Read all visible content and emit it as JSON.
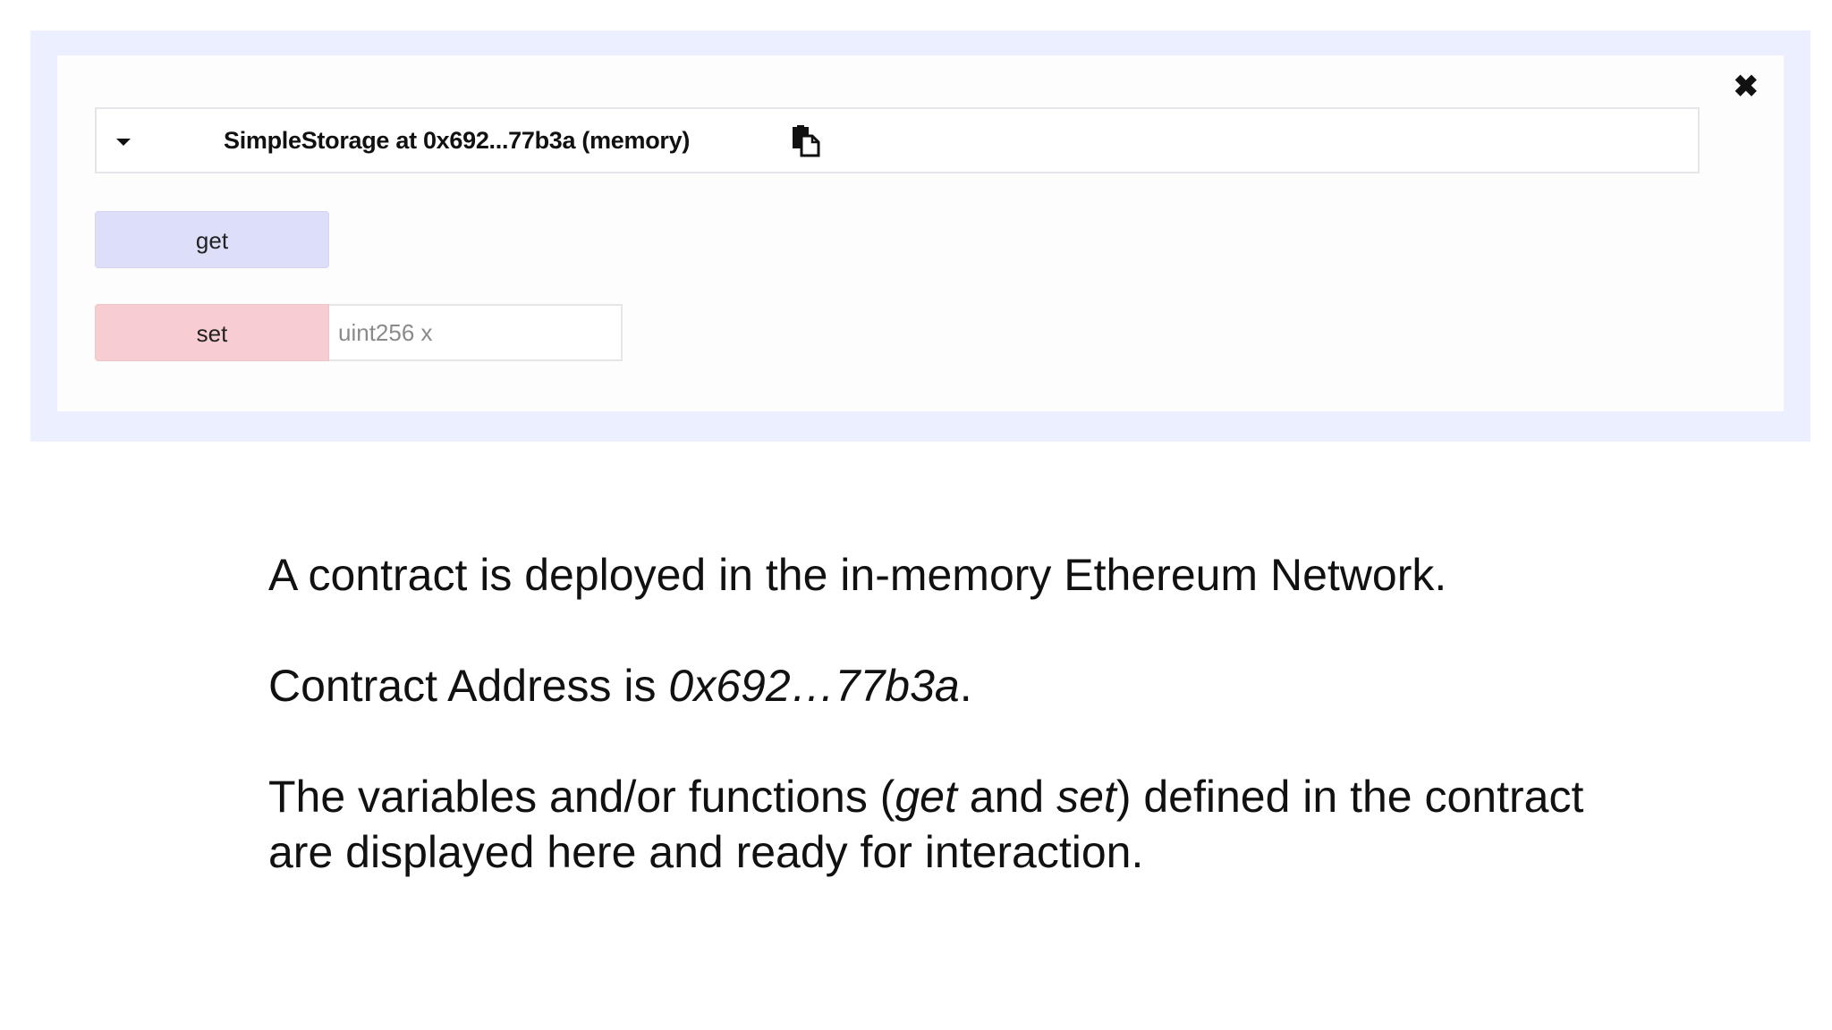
{
  "contract_panel": {
    "close_label": "✖",
    "title": "SimpleStorage at 0x692...77b3a (memory)",
    "copy_icon": "copy-icon",
    "functions": {
      "get_label": "get",
      "set_label": "set",
      "set_input_placeholder": "uint256 x"
    }
  },
  "description": {
    "line1": "A contract is deployed in the in-memory Ethereum Network.",
    "line2_prefix": "Contract Address is ",
    "line2_address": "0x692…77b3a",
    "line2_suffix": ".",
    "line3_part1": "The variables and/or functions (",
    "line3_get": "get",
    "line3_and": " and ",
    "line3_set": "set",
    "line3_part2": ") defined in the contract are displayed here and ready for interaction."
  },
  "colors": {
    "outer_panel": "#ecefff",
    "get_button": "#dcdff7",
    "set_button": "#f7cdd1"
  }
}
